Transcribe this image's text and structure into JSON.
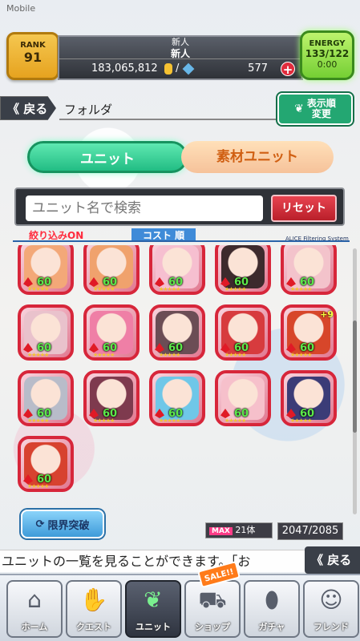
{
  "status": {
    "carrier": "Mobile"
  },
  "player": {
    "rank_label": "RANK",
    "rank": "91",
    "title": "新人",
    "name": "新人",
    "money": "183,065,812",
    "gems": "577",
    "energy_label": "ENERGY",
    "energy": "133/122",
    "energy_timer": "0:00"
  },
  "header": {
    "back_label": "《 戻る",
    "folder_label": "フォルダ",
    "sort_label_1": "表示順",
    "sort_label_2": "変更"
  },
  "tabs": [
    {
      "label": "ユニット",
      "active": true
    },
    {
      "label": "素材ユニット",
      "active": false
    }
  ],
  "search": {
    "placeholder": "ユニット名で検索",
    "reset_label": "リセット"
  },
  "filter": {
    "on_label": "絞り込みON",
    "cost_label": "コスト 順",
    "system_label": "ALICE Filtering System"
  },
  "units": [
    {
      "level": "60",
      "color": "#f3a878",
      "plus": ""
    },
    {
      "level": "60",
      "color": "#f0a26d",
      "plus": ""
    },
    {
      "level": "60",
      "color": "#f6bfd0",
      "plus": ""
    },
    {
      "level": "60",
      "color": "#3d2a2d",
      "plus": ""
    },
    {
      "level": "60",
      "color": "#f3c3cb",
      "plus": ""
    },
    {
      "level": "60",
      "color": "#e9c2cc",
      "plus": ""
    },
    {
      "level": "60",
      "color": "#ef7fa6",
      "plus": ""
    },
    {
      "level": "60",
      "color": "#6b4d55",
      "plus": ""
    },
    {
      "level": "60",
      "color": "#d73b3e",
      "plus": ""
    },
    {
      "level": "60",
      "color": "#d7462a",
      "plus": "+9"
    },
    {
      "level": "60",
      "color": "#b8bcc9",
      "plus": ""
    },
    {
      "level": "60",
      "color": "#7e3a4e",
      "plus": ""
    },
    {
      "level": "60",
      "color": "#6fc7e8",
      "plus": ""
    },
    {
      "level": "60",
      "color": "#f6c0cb",
      "plus": ""
    },
    {
      "level": "60",
      "color": "#3b3c77",
      "plus": ""
    },
    {
      "level": "60",
      "color": "#d7422f",
      "plus": ""
    }
  ],
  "footer": {
    "limit_break_label": "限界突破",
    "max_label": "MAX",
    "max_count": "21体",
    "unit_count": "2047/2085",
    "marquee": "ユニットの一覧を見ることができます。「お",
    "back_label": "《 戻る"
  },
  "nav": {
    "sale_label": "SALE!!",
    "items": [
      {
        "label": "ホーム",
        "icon": "home-icon",
        "glyph": "⌂"
      },
      {
        "label": "クエスト",
        "icon": "handshake-icon",
        "glyph": "✋"
      },
      {
        "label": "ユニット",
        "icon": "rabbit-icon",
        "glyph": "❦"
      },
      {
        "label": "ショップ",
        "icon": "cart-icon",
        "glyph": "⛟"
      },
      {
        "label": "ガチャ",
        "icon": "egg-icon",
        "glyph": "⬮"
      },
      {
        "label": "フレンド",
        "icon": "friends-icon",
        "glyph": "☺"
      }
    ]
  }
}
